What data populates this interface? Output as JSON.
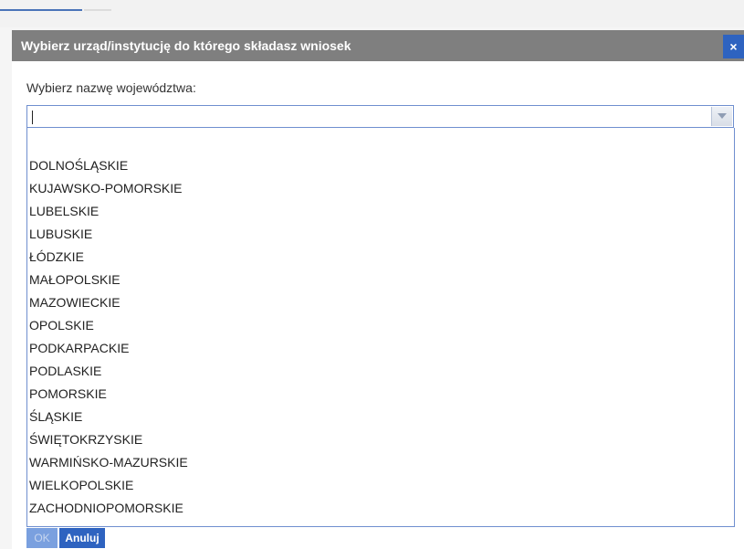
{
  "dialog": {
    "title": "Wybierz urząd/instytucję do którego składasz wniosek",
    "close_label": "×",
    "field_label": "Wybierz nazwę województwa:",
    "input_value": "",
    "options": [
      "",
      "DOLNOŚLĄSKIE",
      "KUJAWSKO-POMORSKIE",
      "LUBELSKIE",
      "LUBUSKIE",
      "ŁÓDZKIE",
      "MAŁOPOLSKIE",
      "MAZOWIECKIE",
      "OPOLSKIE",
      "PODKARPACKIE",
      "PODLASKIE",
      "POMORSKIE",
      "ŚLĄSKIE",
      "ŚWIĘTOKRZYSKIE",
      "WARMIŃSKO-MAZURSKIE",
      "WIELKOPOLSKIE",
      "ZACHODNIOPOMORSKIE"
    ],
    "ok_label": "OK",
    "cancel_label": "Anuluj"
  }
}
